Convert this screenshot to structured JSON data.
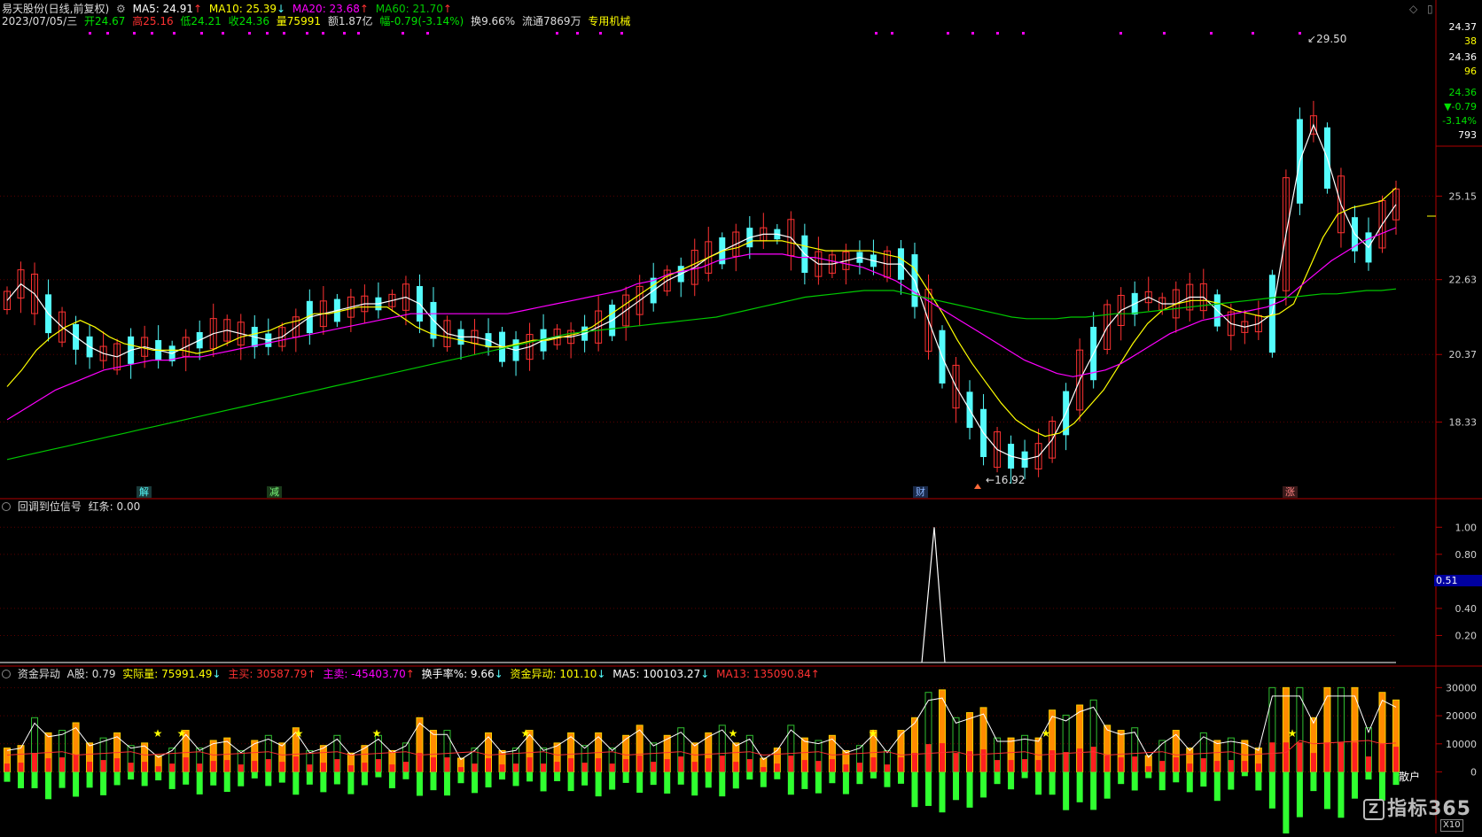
{
  "header": {
    "stock": "易天股份(日线,前复权)",
    "ma5": "MA5: 24.91",
    "ma10": "MA10: 25.39",
    "ma20": "MA20: 23.68",
    "ma60": "MA60: 21.70",
    "date": "2023/07/05/三",
    "open": "开24.67",
    "high": "高25.16",
    "low": "低24.21",
    "close": "收24.36",
    "vol": "量75991",
    "amount": "额1.87亿",
    "change": "幅-0.79(-3.14%)",
    "turnover": "换9.66%",
    "float": "流通7869万",
    "sector": "专用机械"
  },
  "right_panel": {
    "last_price": "24.37",
    "v38": "38",
    "close": "24.36",
    "v96": "96",
    "price2": "24.36",
    "change": "▼-0.79",
    "pct": "-3.14%",
    "v793": "793"
  },
  "signals": {
    "jie": "解",
    "jian": "减",
    "cai": "财",
    "zhang": "涨"
  },
  "annotations": {
    "high": "29.50",
    "low": "16.92"
  },
  "pane2": {
    "title": "回调到位信号",
    "red": "红条: 0.00",
    "highlight": "0.51"
  },
  "pane3": {
    "title": "资金异动",
    "a": "A股: 0.79",
    "actual": "实际量: 75991.49",
    "buy": "主买: 30587.79",
    "sell": "主卖: -45403.70",
    "turn": "换手率%: 9.66",
    "flow": "资金异动: 101.10",
    "ma5": "MA5: 100103.27",
    "ma13": "MA13: 135090.84",
    "retail": "散户",
    "x10": "X10"
  },
  "logo": "指标365",
  "colors": {
    "up": "#ff3232",
    "down": "#54fcfc",
    "ma5": "#ffffff",
    "ma10": "#ffff00",
    "ma20": "#ff00ff",
    "ma60": "#00c800"
  },
  "chart_data": [
    {
      "type": "candlestick",
      "y_ticks": [
        25.15,
        22.63,
        20.37,
        18.33
      ],
      "ylim": [
        16.5,
        30.0
      ],
      "series": [
        {
          "name": "MA5",
          "values": [
            22.0,
            22.5,
            22.2,
            21.6,
            21.2,
            20.9,
            20.6,
            20.4,
            20.3,
            20.5,
            20.6,
            20.5,
            20.4,
            20.6,
            20.8,
            21.0,
            21.1,
            21.0,
            20.9,
            20.8,
            20.9,
            21.2,
            21.5,
            21.6,
            21.7,
            21.8,
            21.9,
            21.9,
            22.0,
            22.1,
            21.9,
            21.4,
            21.0,
            20.9,
            20.9,
            20.8,
            20.6,
            20.5,
            20.6,
            20.8,
            20.9,
            20.9,
            21.0,
            21.2,
            21.4,
            21.7,
            22.0,
            22.3,
            22.6,
            22.8,
            23.0,
            23.3,
            23.5,
            23.7,
            23.9,
            24.0,
            24.0,
            23.9,
            23.4,
            23.1,
            23.1,
            23.2,
            23.3,
            23.2,
            23.1,
            23.1,
            22.6,
            21.4,
            20.3,
            19.4,
            18.7,
            18.0,
            17.5,
            17.3,
            17.2,
            17.3,
            17.8,
            18.6,
            19.6,
            20.4,
            21.2,
            21.7,
            21.9,
            22.1,
            21.9,
            21.9,
            22.1,
            22.1,
            21.7,
            21.3,
            21.2,
            21.3,
            21.6,
            24.0,
            26.2,
            27.3,
            26.3,
            24.9,
            24.0,
            23.6,
            24.3,
            24.9
          ]
        },
        {
          "name": "MA10",
          "values": [
            19.4,
            19.9,
            20.5,
            20.9,
            21.2,
            21.4,
            21.2,
            20.9,
            20.7,
            20.6,
            20.5,
            20.5,
            20.5,
            20.4,
            20.5,
            20.7,
            20.9,
            21.0,
            21.1,
            21.3,
            21.4,
            21.6,
            21.6,
            21.7,
            21.8,
            21.8,
            21.8,
            21.5,
            21.2,
            21.0,
            20.9,
            20.8,
            20.7,
            20.6,
            20.6,
            20.7,
            20.8,
            20.8,
            20.9,
            21.0,
            21.2,
            21.5,
            21.8,
            22.1,
            22.4,
            22.7,
            22.9,
            23.1,
            23.3,
            23.5,
            23.6,
            23.8,
            23.8,
            23.8,
            23.7,
            23.6,
            23.5,
            23.5,
            23.5,
            23.5,
            23.4,
            23.3,
            23.0,
            22.3,
            21.6,
            20.8,
            20.1,
            19.5,
            18.9,
            18.4,
            18.1,
            17.9,
            18.0,
            18.3,
            18.8,
            19.3,
            20.0,
            20.7,
            21.3,
            21.7,
            21.9,
            22.0,
            22.0,
            21.9,
            21.7,
            21.6,
            21.5,
            21.6,
            21.9,
            22.9,
            23.9,
            24.6,
            24.8,
            24.9,
            25.0,
            25.4
          ]
        },
        {
          "name": "MA20",
          "values": [
            18.4,
            18.7,
            19.0,
            19.3,
            19.5,
            19.7,
            19.9,
            20.0,
            20.1,
            20.2,
            20.2,
            20.3,
            20.3,
            20.4,
            20.5,
            20.6,
            20.7,
            20.8,
            20.9,
            21.0,
            21.1,
            21.2,
            21.3,
            21.4,
            21.5,
            21.6,
            21.6,
            21.6,
            21.6,
            21.6,
            21.6,
            21.6,
            21.7,
            21.8,
            21.9,
            22.0,
            22.1,
            22.2,
            22.3,
            22.5,
            22.6,
            22.8,
            22.9,
            23.0,
            23.2,
            23.3,
            23.4,
            23.4,
            23.4,
            23.3,
            23.3,
            23.2,
            23.1,
            23.0,
            22.8,
            22.6,
            22.3,
            22.0,
            21.7,
            21.4,
            21.1,
            20.8,
            20.5,
            20.2,
            20.0,
            19.8,
            19.7,
            19.8,
            19.9,
            20.1,
            20.4,
            20.7,
            21.0,
            21.2,
            21.4,
            21.5,
            21.6,
            21.7,
            21.8,
            22.0,
            22.4,
            22.8,
            23.2,
            23.5,
            23.8,
            24.0,
            24.2
          ]
        },
        {
          "name": "MA60",
          "values": [
            17.2,
            17.3,
            17.4,
            17.5,
            17.6,
            17.7,
            17.8,
            17.9,
            18.0,
            18.1,
            18.2,
            18.3,
            18.4,
            18.5,
            18.6,
            18.7,
            18.8,
            18.9,
            19.0,
            19.1,
            19.2,
            19.3,
            19.4,
            19.5,
            19.6,
            19.7,
            19.8,
            19.9,
            20.0,
            20.1,
            20.2,
            20.3,
            20.4,
            20.5,
            20.6,
            20.7,
            20.8,
            20.9,
            21.0,
            21.05,
            21.1,
            21.15,
            21.2,
            21.25,
            21.3,
            21.35,
            21.4,
            21.45,
            21.5,
            21.6,
            21.7,
            21.8,
            21.9,
            22.0,
            22.1,
            22.15,
            22.2,
            22.25,
            22.3,
            22.3,
            22.3,
            22.2,
            22.1,
            22.0,
            21.9,
            21.8,
            21.7,
            21.6,
            21.5,
            21.45,
            21.45,
            21.45,
            21.5,
            21.5,
            21.55,
            21.6,
            21.6,
            21.65,
            21.7,
            21.75,
            21.8,
            21.85,
            21.9,
            21.95,
            22.0,
            22.05,
            22.1,
            22.1,
            22.15,
            22.2,
            22.2,
            22.25,
            22.3,
            22.3,
            22.35
          ]
        }
      ]
    },
    {
      "type": "line",
      "name": "回调到位信号",
      "y_ticks": [
        1.0,
        0.8,
        0.4,
        0.2
      ],
      "ylim": [
        0,
        1.1
      ]
    },
    {
      "type": "bar",
      "name": "资金异动",
      "y_ticks": [
        30000,
        20000,
        10000,
        0
      ],
      "ylim": [
        -20000,
        32000
      ]
    }
  ]
}
